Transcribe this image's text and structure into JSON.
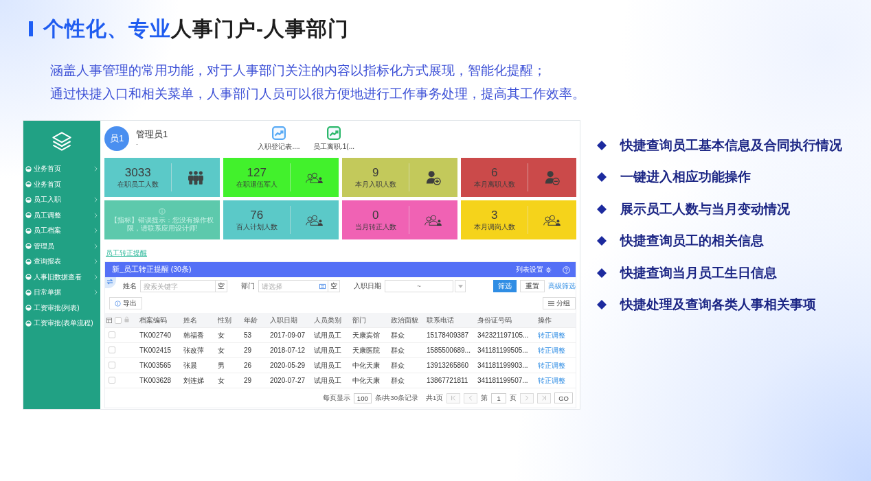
{
  "title": {
    "highlight": "个性化、专业",
    "rest": "人事门户-人事部门"
  },
  "intro": [
    "涵盖人事管理的常用功能，对于人事部门关注的内容以指标化方式展现，智能化提醒；",
    "通过快捷入口和相关菜单，人事部门人员可以很方便地进行工作事务处理，提高其工作效率。"
  ],
  "app": {
    "sidebar": {
      "items": [
        {
          "label": "业务首页",
          "has_submenu": true
        },
        {
          "label": "业务首页",
          "has_submenu": false
        },
        {
          "label": "员工入职",
          "has_submenu": true
        },
        {
          "label": "员工调整",
          "has_submenu": true
        },
        {
          "label": "员工档案",
          "has_submenu": true
        },
        {
          "label": "管理员",
          "has_submenu": true
        },
        {
          "label": "查询报表",
          "has_submenu": true
        },
        {
          "label": "人事旧数据查看",
          "has_submenu": true
        },
        {
          "label": "日常单据",
          "has_submenu": true
        },
        {
          "label": "工资审批(列表)",
          "has_submenu": false
        },
        {
          "label": "工资审批(表单流程)",
          "has_submenu": false
        }
      ]
    },
    "user": {
      "avatar": "员1",
      "name": "管理员1",
      "note": "-"
    },
    "shortcuts": [
      {
        "label": "入职登记表....",
        "color": "#58aaf5"
      },
      {
        "label": "员工离职.1(...",
        "color": "#2bb86a"
      }
    ],
    "tiles": [
      {
        "kind": "team",
        "value": "3033",
        "label": "在职员工人数",
        "color": "#5bc9c8"
      },
      {
        "kind": "group",
        "value": "127",
        "label": "在职退伍军人",
        "color": "#42f12c"
      },
      {
        "kind": "join",
        "value": "9",
        "label": "本月入职人数",
        "color": "#c3c95b"
      },
      {
        "kind": "leave",
        "value": "6",
        "label": "本月离职人数",
        "color": "#cb4a4a"
      },
      {
        "kind": "error",
        "message": "【指标】错误提示：您没有操作权限，请联系应用设计师!",
        "color": "#5dc9ac"
      },
      {
        "kind": "group",
        "value": "76",
        "label": "百人计划人数",
        "color": "#5bc9c8"
      },
      {
        "kind": "group",
        "value": "0",
        "label": "当月转正人数",
        "color": "#f062b4"
      },
      {
        "kind": "group",
        "value": "3",
        "label": "本月调岗人数",
        "color": "#f5d31b"
      }
    ],
    "reminder_link": "员工转正提醒",
    "panel": {
      "title": "新_员工转正提醒 (30条)",
      "settings": "列表设置",
      "filters": [
        {
          "kind": "text",
          "label": "姓名",
          "placeholder": "搜索关键字",
          "clear": "空"
        },
        {
          "kind": "select",
          "label": "部门",
          "placeholder": "请选择",
          "clear": "空"
        },
        {
          "kind": "daterange",
          "label": "入职日期",
          "separator": "~"
        }
      ],
      "filter_button": "筛选",
      "reset_button": "重置",
      "advanced_link": "高级筛选",
      "export_button": "导出",
      "group_button": "分组",
      "table": {
        "all_checked": false,
        "columns": [
          "档案编码",
          "姓名",
          "性别",
          "年龄",
          "入职日期",
          "人员类别",
          "部门",
          "政治面貌",
          "联系电话",
          "身份证号码",
          "操作"
        ],
        "rows": [
          {
            "checked": false,
            "cells": [
              "TK002740",
              "韩福香",
              "女",
              "53",
              "2017-09-07",
              "试用员工",
              "天康宾馆",
              "群众",
              "15178409387",
              "342321197105..."
            ],
            "action": "转正调整"
          },
          {
            "checked": false,
            "cells": [
              "TK002415",
              "张改萍",
              "女",
              "29",
              "2018-07-12",
              "试用员工",
              "天康医院",
              "群众",
              "1585500689...",
              "341181199505..."
            ],
            "action": "转正调整"
          },
          {
            "checked": false,
            "cells": [
              "TK003565",
              "张晨",
              "男",
              "26",
              "2020-05-29",
              "试用员工",
              "中化天康",
              "群众",
              "13913265860",
              "341181199903..."
            ],
            "action": "转正调整"
          },
          {
            "checked": false,
            "cells": [
              "TK003628",
              "刘连娣",
              "女",
              "29",
              "2020-07-27",
              "试用员工",
              "中化天康",
              "群众",
              "13867721811",
              "341181199507..."
            ],
            "action": "转正调整"
          }
        ]
      },
      "pagination": {
        "per_page_label": "每页显示",
        "per_page": "100",
        "total": "条/共30条记录",
        "pages": "共1页",
        "page_label": "第",
        "page": "1",
        "page_suffix": "页",
        "go": "GO",
        "nav_disabled": true
      }
    }
  },
  "highlights": [
    "快捷查询员工基本信息及合同执行情况",
    "一键进入相应功能操作",
    "展示员工人数与当月变动情况",
    "快捷查询员工的相关信息",
    "快捷查询当月员工生日信息",
    "快捷处理及查询各类人事相关事项"
  ]
}
